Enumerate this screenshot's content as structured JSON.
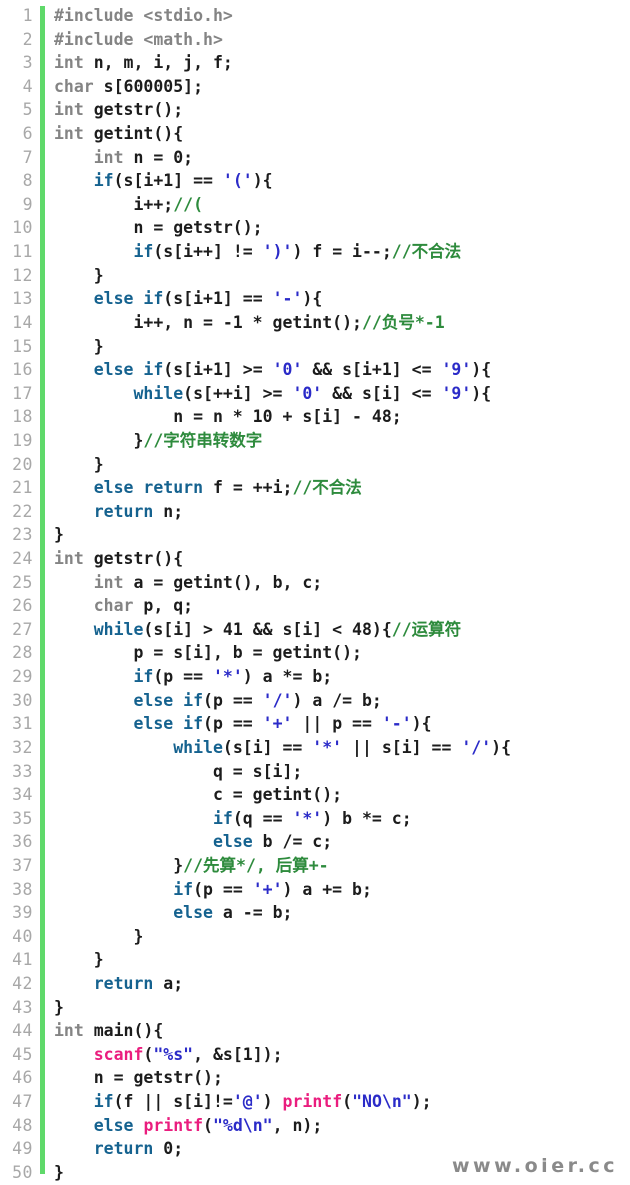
{
  "viewer": {
    "title": "C source code listing",
    "language": "C",
    "total_lines": 50,
    "background_color": "#ffffff",
    "gutter_accent_color": "#5fd96a"
  },
  "watermark": {
    "text": "www.oier.cc",
    "color": "#8a8a8a"
  },
  "palette": {
    "plain": "#1c1c1c",
    "keyword": "#15628f",
    "type": "#848484",
    "string": "#2b2bc8",
    "comment": "#2e8b3d",
    "library_function": "#ea1d7e",
    "preprocessor": "#848484",
    "line_number": "#a8a8a8"
  },
  "lines": [
    {
      "n": "1",
      "tokens": [
        {
          "t": "#include <stdio.h>",
          "c": "pre"
        }
      ]
    },
    {
      "n": "2",
      "tokens": [
        {
          "t": "#include <math.h>",
          "c": "pre"
        }
      ]
    },
    {
      "n": "3",
      "tokens": [
        {
          "t": "int",
          "c": "type"
        },
        {
          "t": " n, m, i, j, f;",
          "c": "plain"
        }
      ]
    },
    {
      "n": "4",
      "tokens": [
        {
          "t": "char",
          "c": "type"
        },
        {
          "t": " s[600005];",
          "c": "plain"
        }
      ]
    },
    {
      "n": "5",
      "tokens": [
        {
          "t": "int",
          "c": "type"
        },
        {
          "t": " getstr();",
          "c": "plain"
        }
      ]
    },
    {
      "n": "6",
      "tokens": [
        {
          "t": "int",
          "c": "type"
        },
        {
          "t": " getint(){",
          "c": "plain"
        }
      ]
    },
    {
      "n": "7",
      "tokens": [
        {
          "t": "    ",
          "c": "plain"
        },
        {
          "t": "int",
          "c": "type"
        },
        {
          "t": " n = 0;",
          "c": "plain"
        }
      ]
    },
    {
      "n": "8",
      "tokens": [
        {
          "t": "    ",
          "c": "plain"
        },
        {
          "t": "if",
          "c": "kw"
        },
        {
          "t": "(s[i+1] == ",
          "c": "plain"
        },
        {
          "t": "'('",
          "c": "str"
        },
        {
          "t": "){",
          "c": "plain"
        }
      ]
    },
    {
      "n": "9",
      "tokens": [
        {
          "t": "        i++;",
          "c": "plain"
        },
        {
          "t": "//(",
          "c": "comment"
        }
      ]
    },
    {
      "n": "10",
      "tokens": [
        {
          "t": "        n = getstr();",
          "c": "plain"
        }
      ]
    },
    {
      "n": "11",
      "tokens": [
        {
          "t": "        ",
          "c": "plain"
        },
        {
          "t": "if",
          "c": "kw"
        },
        {
          "t": "(s[i++] != ",
          "c": "plain"
        },
        {
          "t": "')'",
          "c": "str"
        },
        {
          "t": ") f = i--;",
          "c": "plain"
        },
        {
          "t": "//不合法",
          "c": "comment"
        }
      ]
    },
    {
      "n": "12",
      "tokens": [
        {
          "t": "    }",
          "c": "plain"
        }
      ]
    },
    {
      "n": "13",
      "tokens": [
        {
          "t": "    ",
          "c": "plain"
        },
        {
          "t": "else if",
          "c": "kw"
        },
        {
          "t": "(s[i+1] == ",
          "c": "plain"
        },
        {
          "t": "'-'",
          "c": "str"
        },
        {
          "t": "){",
          "c": "plain"
        }
      ]
    },
    {
      "n": "14",
      "tokens": [
        {
          "t": "        i++, n = -1 * getint();",
          "c": "plain"
        },
        {
          "t": "//负号*-1",
          "c": "comment"
        }
      ]
    },
    {
      "n": "15",
      "tokens": [
        {
          "t": "    }",
          "c": "plain"
        }
      ]
    },
    {
      "n": "16",
      "tokens": [
        {
          "t": "    ",
          "c": "plain"
        },
        {
          "t": "else if",
          "c": "kw"
        },
        {
          "t": "(s[i+1] >= ",
          "c": "plain"
        },
        {
          "t": "'0'",
          "c": "str"
        },
        {
          "t": " && s[i+1] <= ",
          "c": "plain"
        },
        {
          "t": "'9'",
          "c": "str"
        },
        {
          "t": "){",
          "c": "plain"
        }
      ]
    },
    {
      "n": "17",
      "tokens": [
        {
          "t": "        ",
          "c": "plain"
        },
        {
          "t": "while",
          "c": "kw"
        },
        {
          "t": "(s[++i] >= ",
          "c": "plain"
        },
        {
          "t": "'0'",
          "c": "str"
        },
        {
          "t": " && s[i] <= ",
          "c": "plain"
        },
        {
          "t": "'9'",
          "c": "str"
        },
        {
          "t": "){",
          "c": "plain"
        }
      ]
    },
    {
      "n": "18",
      "tokens": [
        {
          "t": "            n = n * 10 + s[i] - 48;",
          "c": "plain"
        }
      ]
    },
    {
      "n": "19",
      "tokens": [
        {
          "t": "        }",
          "c": "plain"
        },
        {
          "t": "//字符串转数字",
          "c": "comment"
        }
      ]
    },
    {
      "n": "20",
      "tokens": [
        {
          "t": "    }",
          "c": "plain"
        }
      ]
    },
    {
      "n": "21",
      "tokens": [
        {
          "t": "    ",
          "c": "plain"
        },
        {
          "t": "else return",
          "c": "kw"
        },
        {
          "t": " f = ++i;",
          "c": "plain"
        },
        {
          "t": "//不合法",
          "c": "comment"
        }
      ]
    },
    {
      "n": "22",
      "tokens": [
        {
          "t": "    ",
          "c": "plain"
        },
        {
          "t": "return",
          "c": "kw"
        },
        {
          "t": " n;",
          "c": "plain"
        }
      ]
    },
    {
      "n": "23",
      "tokens": [
        {
          "t": "}",
          "c": "plain"
        }
      ]
    },
    {
      "n": "24",
      "tokens": [
        {
          "t": "int",
          "c": "type"
        },
        {
          "t": " getstr(){",
          "c": "plain"
        }
      ]
    },
    {
      "n": "25",
      "tokens": [
        {
          "t": "    ",
          "c": "plain"
        },
        {
          "t": "int",
          "c": "type"
        },
        {
          "t": " a = getint(), b, c;",
          "c": "plain"
        }
      ]
    },
    {
      "n": "26",
      "tokens": [
        {
          "t": "    ",
          "c": "plain"
        },
        {
          "t": "char",
          "c": "type"
        },
        {
          "t": " p, q;",
          "c": "plain"
        }
      ]
    },
    {
      "n": "27",
      "tokens": [
        {
          "t": "    ",
          "c": "plain"
        },
        {
          "t": "while",
          "c": "kw"
        },
        {
          "t": "(s[i] > 41 && s[i] < 48){",
          "c": "plain"
        },
        {
          "t": "//运算符",
          "c": "comment"
        }
      ]
    },
    {
      "n": "28",
      "tokens": [
        {
          "t": "        p = s[i], b = getint();",
          "c": "plain"
        }
      ]
    },
    {
      "n": "29",
      "tokens": [
        {
          "t": "        ",
          "c": "plain"
        },
        {
          "t": "if",
          "c": "kw"
        },
        {
          "t": "(p == ",
          "c": "plain"
        },
        {
          "t": "'*'",
          "c": "str"
        },
        {
          "t": ") a *= b;",
          "c": "plain"
        }
      ]
    },
    {
      "n": "30",
      "tokens": [
        {
          "t": "        ",
          "c": "plain"
        },
        {
          "t": "else if",
          "c": "kw"
        },
        {
          "t": "(p == ",
          "c": "plain"
        },
        {
          "t": "'/'",
          "c": "str"
        },
        {
          "t": ") a /= b;",
          "c": "plain"
        }
      ]
    },
    {
      "n": "31",
      "tokens": [
        {
          "t": "        ",
          "c": "plain"
        },
        {
          "t": "else if",
          "c": "kw"
        },
        {
          "t": "(p == ",
          "c": "plain"
        },
        {
          "t": "'+'",
          "c": "str"
        },
        {
          "t": " || p == ",
          "c": "plain"
        },
        {
          "t": "'-'",
          "c": "str"
        },
        {
          "t": "){",
          "c": "plain"
        }
      ]
    },
    {
      "n": "32",
      "tokens": [
        {
          "t": "            ",
          "c": "plain"
        },
        {
          "t": "while",
          "c": "kw"
        },
        {
          "t": "(s[i] == ",
          "c": "plain"
        },
        {
          "t": "'*'",
          "c": "str"
        },
        {
          "t": " || s[i] == ",
          "c": "plain"
        },
        {
          "t": "'/'",
          "c": "str"
        },
        {
          "t": "){",
          "c": "plain"
        }
      ]
    },
    {
      "n": "33",
      "tokens": [
        {
          "t": "                q = s[i];",
          "c": "plain"
        }
      ]
    },
    {
      "n": "34",
      "tokens": [
        {
          "t": "                c = getint();",
          "c": "plain"
        }
      ]
    },
    {
      "n": "35",
      "tokens": [
        {
          "t": "                ",
          "c": "plain"
        },
        {
          "t": "if",
          "c": "kw"
        },
        {
          "t": "(q == ",
          "c": "plain"
        },
        {
          "t": "'*'",
          "c": "str"
        },
        {
          "t": ") b *= c;",
          "c": "plain"
        }
      ]
    },
    {
      "n": "36",
      "tokens": [
        {
          "t": "                ",
          "c": "plain"
        },
        {
          "t": "else",
          "c": "kw"
        },
        {
          "t": " b /= c;",
          "c": "plain"
        }
      ]
    },
    {
      "n": "37",
      "tokens": [
        {
          "t": "            }",
          "c": "plain"
        },
        {
          "t": "//先算*/, 后算+-",
          "c": "comment"
        }
      ]
    },
    {
      "n": "38",
      "tokens": [
        {
          "t": "            ",
          "c": "plain"
        },
        {
          "t": "if",
          "c": "kw"
        },
        {
          "t": "(p == ",
          "c": "plain"
        },
        {
          "t": "'+'",
          "c": "str"
        },
        {
          "t": ") a += b;",
          "c": "plain"
        }
      ]
    },
    {
      "n": "39",
      "tokens": [
        {
          "t": "            ",
          "c": "plain"
        },
        {
          "t": "else",
          "c": "kw"
        },
        {
          "t": " a -= b;",
          "c": "plain"
        }
      ]
    },
    {
      "n": "40",
      "tokens": [
        {
          "t": "        }",
          "c": "plain"
        }
      ]
    },
    {
      "n": "41",
      "tokens": [
        {
          "t": "    }",
          "c": "plain"
        }
      ]
    },
    {
      "n": "42",
      "tokens": [
        {
          "t": "    ",
          "c": "plain"
        },
        {
          "t": "return",
          "c": "kw"
        },
        {
          "t": " a;",
          "c": "plain"
        }
      ]
    },
    {
      "n": "43",
      "tokens": [
        {
          "t": "}",
          "c": "plain"
        }
      ]
    },
    {
      "n": "44",
      "tokens": [
        {
          "t": "int",
          "c": "type"
        },
        {
          "t": " main(){",
          "c": "plain"
        }
      ]
    },
    {
      "n": "45",
      "tokens": [
        {
          "t": "    ",
          "c": "plain"
        },
        {
          "t": "scanf",
          "c": "lib"
        },
        {
          "t": "(",
          "c": "plain"
        },
        {
          "t": "\"%s\"",
          "c": "str"
        },
        {
          "t": ", &s[1]);",
          "c": "plain"
        }
      ]
    },
    {
      "n": "46",
      "tokens": [
        {
          "t": "    n = getstr();",
          "c": "plain"
        }
      ]
    },
    {
      "n": "47",
      "tokens": [
        {
          "t": "    ",
          "c": "plain"
        },
        {
          "t": "if",
          "c": "kw"
        },
        {
          "t": "(f || s[i]!=",
          "c": "plain"
        },
        {
          "t": "'@'",
          "c": "str"
        },
        {
          "t": ") ",
          "c": "plain"
        },
        {
          "t": "printf",
          "c": "lib"
        },
        {
          "t": "(",
          "c": "plain"
        },
        {
          "t": "\"NO\\n\"",
          "c": "str"
        },
        {
          "t": ");",
          "c": "plain"
        }
      ]
    },
    {
      "n": "48",
      "tokens": [
        {
          "t": "    ",
          "c": "plain"
        },
        {
          "t": "else",
          "c": "kw"
        },
        {
          "t": " ",
          "c": "plain"
        },
        {
          "t": "printf",
          "c": "lib"
        },
        {
          "t": "(",
          "c": "plain"
        },
        {
          "t": "\"%d\\n\"",
          "c": "str"
        },
        {
          "t": ", n);",
          "c": "plain"
        }
      ]
    },
    {
      "n": "49",
      "tokens": [
        {
          "t": "    ",
          "c": "plain"
        },
        {
          "t": "return",
          "c": "kw"
        },
        {
          "t": " 0;",
          "c": "plain"
        }
      ]
    },
    {
      "n": "50",
      "tokens": [
        {
          "t": "}",
          "c": "plain"
        }
      ]
    }
  ]
}
